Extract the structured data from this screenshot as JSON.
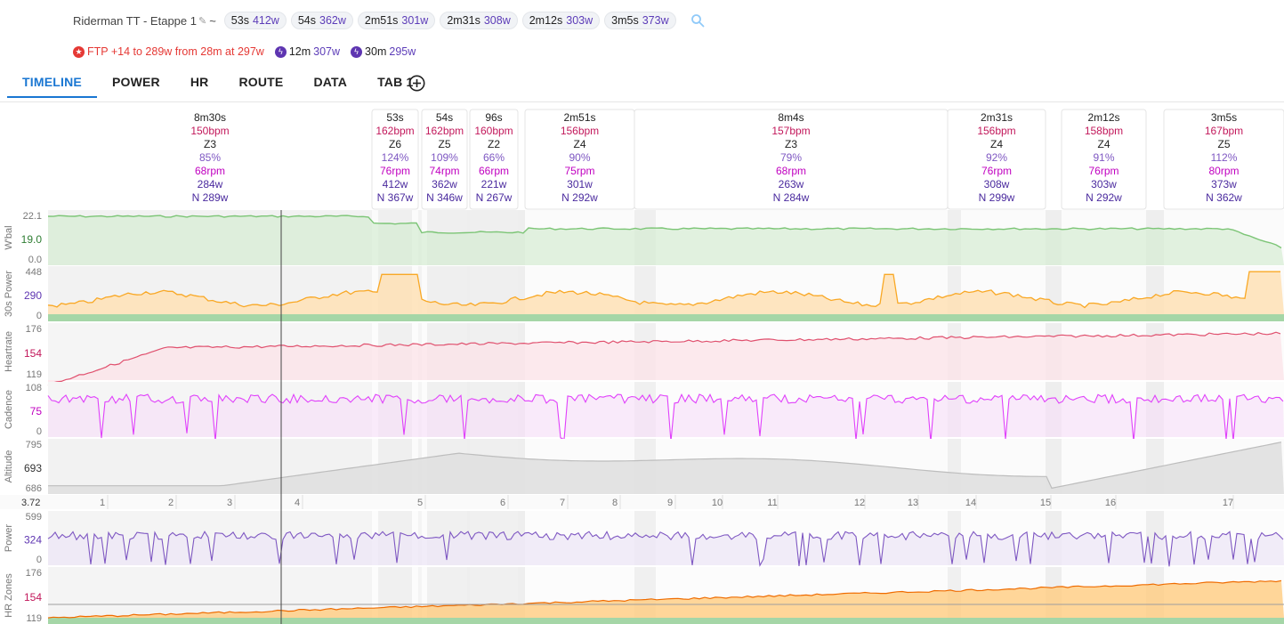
{
  "header": {
    "title": "Riderman TT - Etappe 1",
    "tilde": "~",
    "intervals": [
      {
        "dur": "53s",
        "watts": "412w"
      },
      {
        "dur": "54s",
        "watts": "362w"
      },
      {
        "dur": "2m51s",
        "watts": "301w"
      },
      {
        "dur": "2m31s",
        "watts": "308w"
      },
      {
        "dur": "2m12s",
        "watts": "303w"
      },
      {
        "dur": "3m5s",
        "watts": "373w"
      }
    ],
    "search_icon": "search-icon",
    "ftp_text": "FTP +14 to 289w from 28m at 297w",
    "peaks": [
      {
        "dur": "12m",
        "watts": "307w"
      },
      {
        "dur": "30m",
        "watts": "295w"
      }
    ]
  },
  "tabs": [
    "TIMELINE",
    "POWER",
    "HR",
    "ROUTE",
    "DATA",
    "TAB 1"
  ],
  "colors": {
    "accent": "#1976d2",
    "power": "#7e57c2",
    "hr": "#e0506e",
    "cadence": "#e040fb",
    "wbal": "#7cc576",
    "altitude": "#bdbdbd",
    "lap_bpm": "#c2185b",
    "lap_pct": "#7e57c2",
    "lap_rpm": "#c000c0",
    "lap_watts": "#4a2a9e"
  },
  "laps": [
    {
      "dur": "8m30s",
      "bpm": "150bpm",
      "zone": "Z3",
      "pct": "85%",
      "rpm": "68rpm",
      "watts": "284w",
      "np": "N 289w"
    },
    {
      "dur": "53s",
      "bpm": "162bpm",
      "zone": "Z6",
      "pct": "124%",
      "rpm": "76rpm",
      "watts": "412w",
      "np": "N 367w"
    },
    {
      "dur": "54s",
      "bpm": "162bpm",
      "zone": "Z5",
      "pct": "109%",
      "rpm": "74rpm",
      "watts": "362w",
      "np": "N 346w"
    },
    {
      "dur": "96s",
      "bpm": "160bpm",
      "zone": "Z2",
      "pct": "66%",
      "rpm": "66rpm",
      "watts": "221w",
      "np": "N 267w"
    },
    {
      "dur": "2m51s",
      "bpm": "156bpm",
      "zone": "Z4",
      "pct": "90%",
      "rpm": "75rpm",
      "watts": "301w",
      "np": "N 292w"
    },
    {
      "dur": "8m4s",
      "bpm": "157bpm",
      "zone": "Z3",
      "pct": "79%",
      "rpm": "68rpm",
      "watts": "263w",
      "np": "N 284w"
    },
    {
      "dur": "2m31s",
      "bpm": "156bpm",
      "zone": "Z4",
      "pct": "92%",
      "rpm": "76rpm",
      "watts": "308w",
      "np": "N 299w"
    },
    {
      "dur": "2m12s",
      "bpm": "158bpm",
      "zone": "Z4",
      "pct": "91%",
      "rpm": "76rpm",
      "watts": "303w",
      "np": "N 292w"
    },
    {
      "dur": "3m5s",
      "bpm": "167bpm",
      "zone": "Z5",
      "pct": "112%",
      "rpm": "80rpm",
      "watts": "373w",
      "np": "N 362w"
    }
  ],
  "panels": [
    {
      "label": "W'bal",
      "ticks": [
        "22.1",
        "19.0",
        "0.0"
      ]
    },
    {
      "label": "30s Power",
      "ticks": [
        "448",
        "290",
        "0"
      ]
    },
    {
      "label": "Heartrate",
      "ticks": [
        "176",
        "154",
        "119"
      ]
    },
    {
      "label": "Cadence",
      "ticks": [
        "108",
        "75",
        "0"
      ]
    },
    {
      "label": "Altitude",
      "ticks": [
        "795",
        "693",
        "686"
      ]
    },
    {
      "label": "Power",
      "ticks": [
        "599",
        "324",
        "0"
      ]
    },
    {
      "label": "HR Zones",
      "ticks": [
        "176",
        "154",
        "119"
      ]
    }
  ],
  "distance_start": "3.72",
  "distance_ticks": [
    "1",
    "2",
    "3",
    "4",
    "5",
    "6",
    "7",
    "8",
    "9",
    "10",
    "11",
    "12",
    "13",
    "14",
    "15",
    "16",
    "17"
  ]
}
